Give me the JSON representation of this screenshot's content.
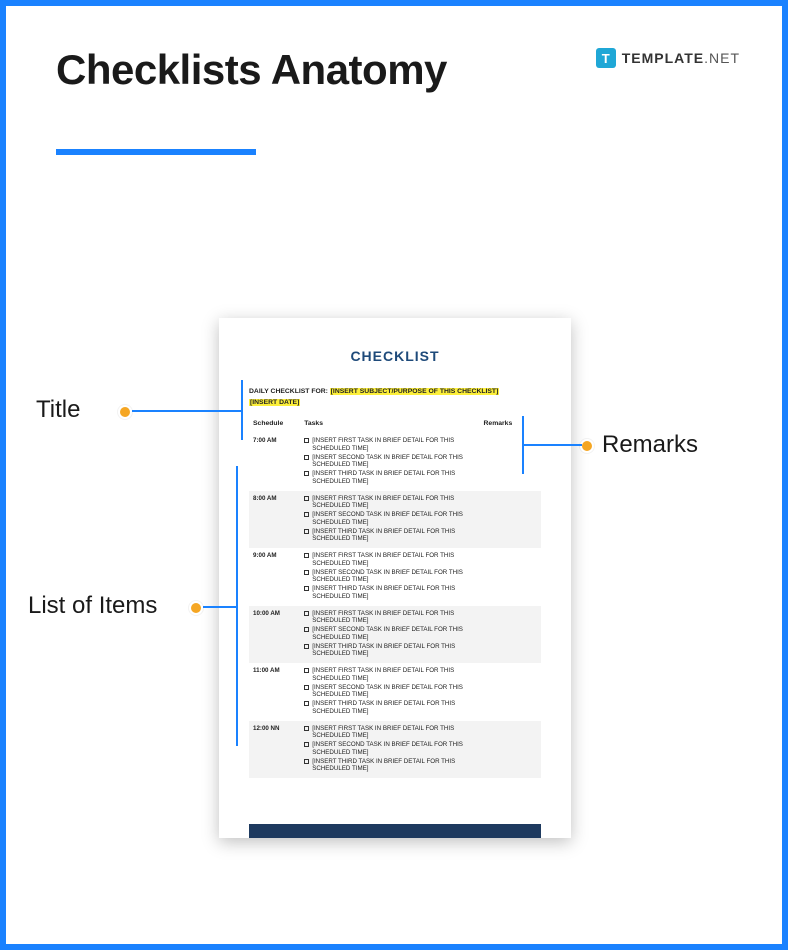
{
  "brand": {
    "icon_letter": "T",
    "name_bold": "TEMPLATE",
    "name_light": ".NET"
  },
  "page": {
    "title": "Checklists Anatomy"
  },
  "callouts": {
    "title": "Title",
    "list": "List of Items",
    "remarks": "Remarks"
  },
  "document": {
    "heading": "CHECKLIST",
    "subtitle_label": "DAILY CHECKLIST FOR:",
    "subtitle_placeholder": "[INSERT SUBJECT/PURPOSE OF THIS CHECKLIST]",
    "date_placeholder": "[INSERT DATE]",
    "columns": {
      "schedule": "Schedule",
      "tasks": "Tasks",
      "remarks": "Remarks"
    },
    "task_templates": [
      "[INSERT FIRST TASK IN BRIEF DETAIL FOR THIS SCHEDULED TIME]",
      "[INSERT SECOND TASK IN BRIEF DETAIL FOR THIS SCHEDULED TIME]",
      "[INSERT THIRD TASK IN BRIEF DETAIL FOR THIS SCHEDULED TIME]"
    ],
    "times": [
      "7:00 AM",
      "8:00 AM",
      "9:00 AM",
      "10:00 AM",
      "11:00 AM",
      "12:00 NN"
    ]
  }
}
